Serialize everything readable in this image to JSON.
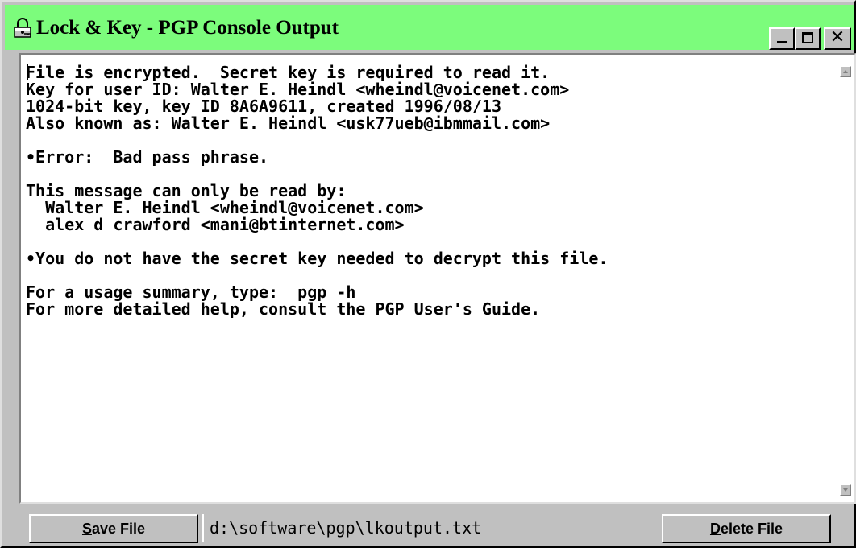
{
  "window": {
    "title": "Lock & Key - PGP Console Output",
    "title_bar_color": "#7cfc7c",
    "icon": "lock-key-icon",
    "minimize_glyph": "_",
    "close_glyph": "✕"
  },
  "output": {
    "text": "File is encrypted.  Secret key is required to read it.\nKey for user ID: Walter E. Heindl <wheindl@voicenet.com>\n1024-bit key, key ID 8A6A9611, created 1996/08/13\nAlso known as: Walter E. Heindl <usk77ueb@ibmmail.com>\n\n•Error:  Bad pass phrase.\n\nThis message can only be read by:\n  Walter E. Heindl <wheindl@voicenet.com>\n  alex d crawford <mani@btinternet.com>\n\n•You do not have the secret key needed to decrypt this file.\n\nFor a usage summary, type:  pgp -h\nFor more detailed help, consult the PGP User's Guide."
  },
  "footer": {
    "save_button": {
      "mnemonic": "S",
      "rest": "ave File"
    },
    "file_path": "d:\\software\\pgp\\lkoutput.txt",
    "delete_button": {
      "mnemonic": "D",
      "rest": "elete File"
    }
  }
}
